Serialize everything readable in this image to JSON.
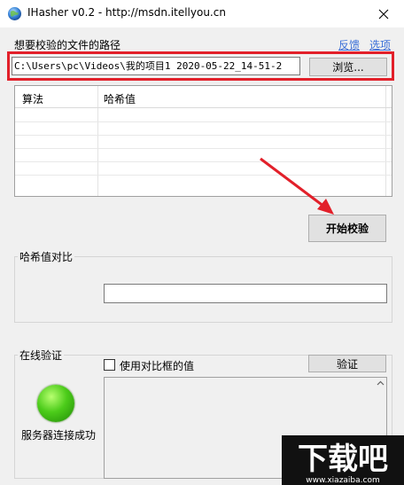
{
  "window": {
    "title": "IHasher v0.2 - http://msdn.itellyou.cn",
    "icon": "globe-icon",
    "close_icon": "close-icon"
  },
  "path": {
    "label": "想要校验的文件的路径",
    "value": "C:\\Users\\pc\\Videos\\我的项目1 2020-05-22_14-51-2",
    "browse_label": "浏览...",
    "highlight_color": "#e2202a"
  },
  "links": {
    "feedback": "反馈",
    "options": "选项",
    "color": "#3a6fd8"
  },
  "hash_table": {
    "columns": [
      "算法",
      "哈希值"
    ],
    "rows": []
  },
  "start_button": "开始校验",
  "compare": {
    "title": "哈希值对比",
    "value": ""
  },
  "online": {
    "title": "在线验证",
    "use_compare_label": "使用对比框的值",
    "use_compare_checked": false,
    "verify_label": "验证",
    "output": "",
    "status_text": "服务器连接成功",
    "status_color": "#4ccc1a",
    "status_icon": "green-status-light-icon"
  },
  "watermark": {
    "main": "下载吧",
    "url": "www.xiazaiba.com"
  }
}
